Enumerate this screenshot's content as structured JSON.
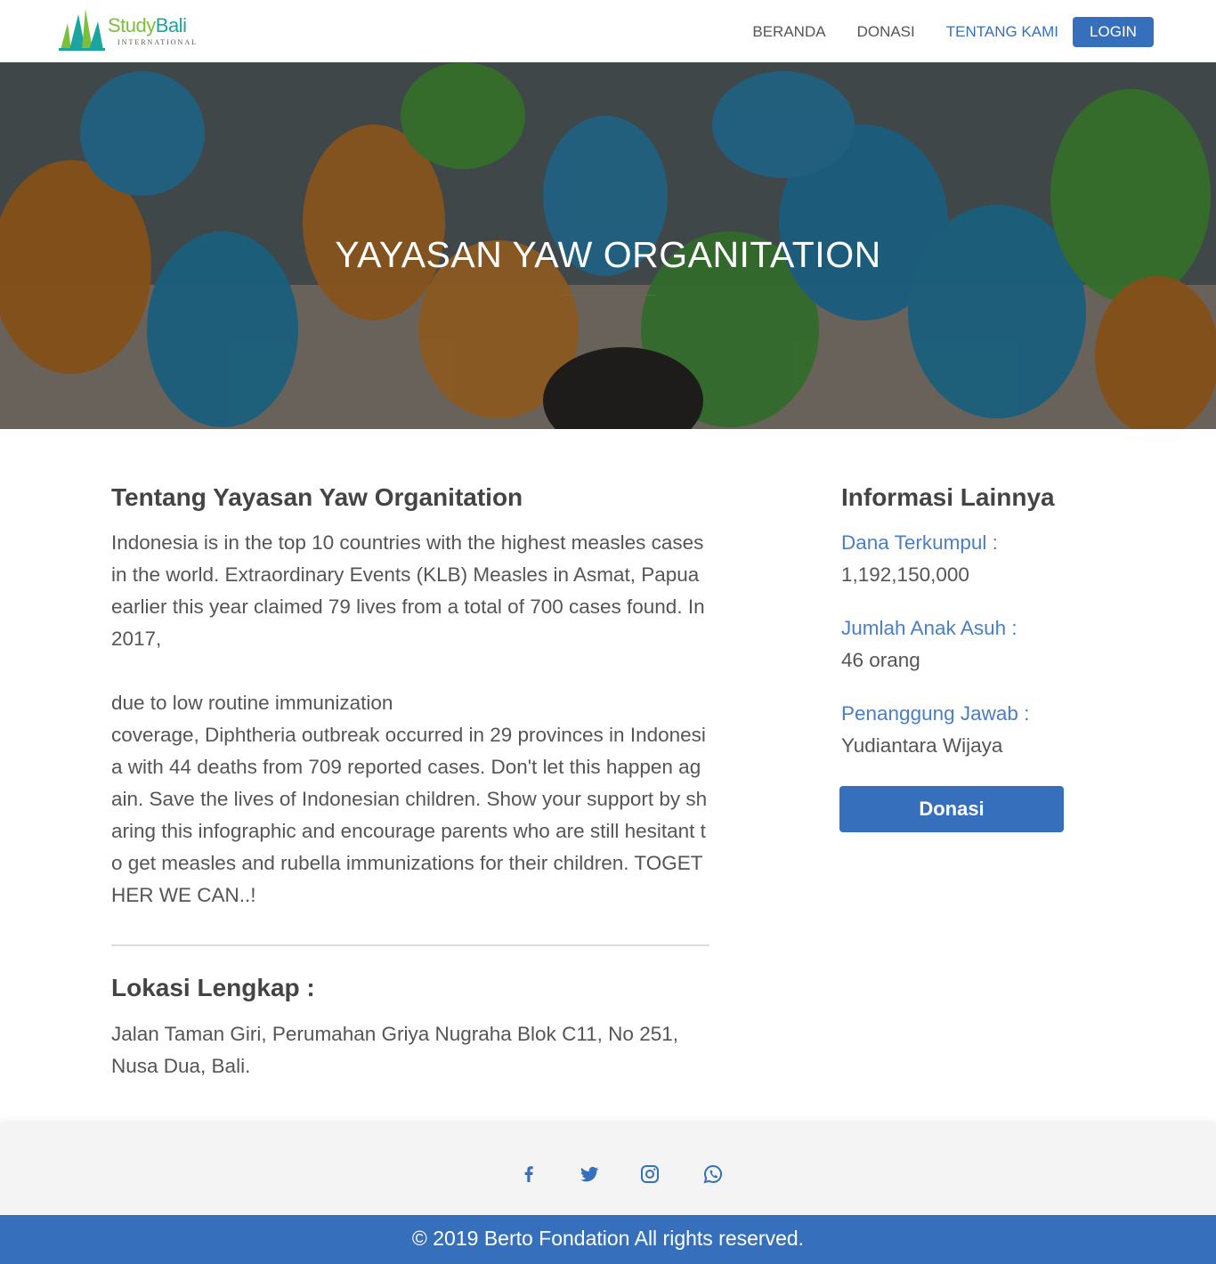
{
  "brand": {
    "name_part1": "Study",
    "name_part2": "Bali",
    "subtitle": "INTERNATIONAL"
  },
  "nav": {
    "items": [
      {
        "label": "BERANDA",
        "active": false
      },
      {
        "label": "DONASI",
        "active": false
      },
      {
        "label": "TENTANG KAMI",
        "active": true
      }
    ],
    "login_label": "LOGIN"
  },
  "hero": {
    "title": "YAYASAN YAW ORGANITATION"
  },
  "about": {
    "title": "Tentang Yayasan Yaw Organitation",
    "paragraph1": "Indonesia is in the top 10 countries with the highest measles cases in the world. Extraordinary Events (KLB) Measles in Asmat, Papua earlier this year claimed 79 lives from a total of 700 cases found. In 2017,",
    "paragraph2_line1": "due to low routine immunization",
    "paragraph2_rest": "coverage, Diphtheria outbreak occurred in 29 provinces in Indonesia with 44 deaths from 709 reported cases. Don't let this happen again. Save the lives of Indonesian children. Show your support by sharing this infographic and encourage parents who are still hesitant to get measles and rubella immunizations for their children. TOGETHER WE CAN..!"
  },
  "location": {
    "title": "Lokasi Lengkap :",
    "address": "Jalan Taman Giri, Perumahan Griya Nugraha Blok C11, No 251, Nusa Dua, Bali."
  },
  "sidebar": {
    "title": "Informasi Lainnya",
    "items": [
      {
        "label": "Dana Terkumpul :",
        "value": "1,192,150,000"
      },
      {
        "label": "Jumlah Anak Asuh :",
        "value": "46 orang"
      },
      {
        "label": "Penanggung Jawab :",
        "value": "Yudiantara Wijaya"
      }
    ],
    "donate_label": "Donasi"
  },
  "footer": {
    "social": [
      "facebook-icon",
      "twitter-icon",
      "instagram-icon",
      "whatsapp-icon"
    ],
    "copyright": "© 2019 Berto Fondation All rights reserved."
  },
  "colors": {
    "primary": "#3670bd",
    "logo_green": "#7cbf3b",
    "logo_teal": "#1aa5a0"
  }
}
